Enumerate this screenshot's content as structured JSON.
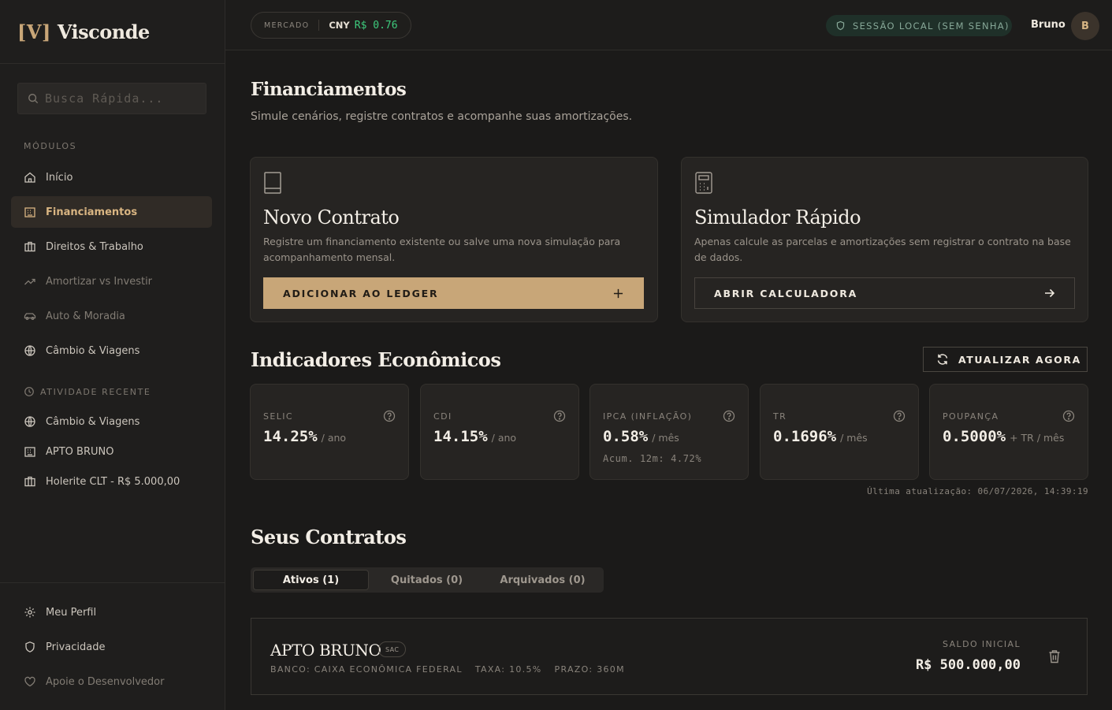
{
  "brand": {
    "logo": "[V]",
    "name": "Visconde"
  },
  "search": {
    "placeholder": "Busca Rápida..."
  },
  "sidebar": {
    "modules_label": "MÓDULOS",
    "items": [
      {
        "label": "Início",
        "icon": "home-icon"
      },
      {
        "label": "Financiamentos",
        "icon": "bank-icon",
        "active": true
      },
      {
        "label": "Direitos & Trabalho",
        "icon": "briefcase-icon"
      },
      {
        "label": "Amortizar vs Investir",
        "icon": "trend-icon",
        "dim": true
      },
      {
        "label": "Auto & Moradia",
        "icon": "car-icon",
        "dim": true
      },
      {
        "label": "Câmbio & Viagens",
        "icon": "globe-icon"
      }
    ],
    "recent_label": "ATIVIDADE RECENTE",
    "recent": [
      {
        "label": "Câmbio & Viagens",
        "icon": "globe-icon"
      },
      {
        "label": "APTO BRUNO",
        "icon": "bank-icon"
      },
      {
        "label": "Holerite CLT - R$ 5.000,00",
        "icon": "briefcase-icon"
      }
    ],
    "bottom": [
      {
        "label": "Meu Perfil",
        "icon": "gear-icon"
      },
      {
        "label": "Privacidade",
        "icon": "shield-icon"
      },
      {
        "label": "Apoie o Desenvolvedor",
        "icon": "heart-icon",
        "dim": true
      }
    ]
  },
  "topbar": {
    "market_label": "MERCADO",
    "currency": "CNY",
    "rate": "R$ 0.76",
    "session": "SESSÃO LOCAL (SEM SENHA)",
    "user": "Bruno",
    "avatar": "B"
  },
  "page": {
    "title": "Financiamentos",
    "subtitle": "Simule cenários, registre contratos e acompanhe suas amortizações."
  },
  "cards": {
    "new_contract": {
      "title": "Novo Contrato",
      "desc": "Registre um financiamento existente ou salve uma nova simulação para acompanhamento mensal.",
      "button": "ADICIONAR AO LEDGER"
    },
    "simulator": {
      "title": "Simulador Rápido",
      "desc": "Apenas calcule as parcelas e amortizações sem registrar o contrato na base de dados.",
      "button": "ABRIR CALCULADORA"
    }
  },
  "indicators": {
    "title": "Indicadores Econômicos",
    "refresh": "ATUALIZAR AGORA",
    "items": [
      {
        "name": "SELIC",
        "value": "14.25%",
        "unit": "/ ano",
        "extra": ""
      },
      {
        "name": "CDI",
        "value": "14.15%",
        "unit": "/ ano",
        "extra": ""
      },
      {
        "name": "IPCA (INFLAÇÃO)",
        "value": "0.58%",
        "unit": "/ mês",
        "extra": "Acum. 12m: 4.72%"
      },
      {
        "name": "TR",
        "value": "0.1696%",
        "unit": "/ mês",
        "extra": ""
      },
      {
        "name": "POUPANÇA",
        "value": "0.5000%",
        "unit": "+ TR / mês",
        "extra": ""
      }
    ],
    "last_update": "Última atualização: 06/07/2026, 14:39:19"
  },
  "contracts": {
    "title": "Seus Contratos",
    "tabs": [
      {
        "label": "Ativos (1)",
        "active": true
      },
      {
        "label": "Quitados (0)"
      },
      {
        "label": "Arquivados (0)"
      }
    ],
    "items": [
      {
        "name": "APTO BRUNO",
        "badge": "SAC",
        "bank": "BANCO: CAIXA ECONÔMICA FEDERAL",
        "rate": "TAXA: 10.5%",
        "term": "PRAZO: 360M",
        "balance_label": "SALDO INICIAL",
        "balance": "R$ 500.000,00"
      }
    ]
  },
  "colors": {
    "accent": "#c8a678",
    "background": "#1b1a19",
    "card": "#262422",
    "positive": "#3ecb7d"
  }
}
